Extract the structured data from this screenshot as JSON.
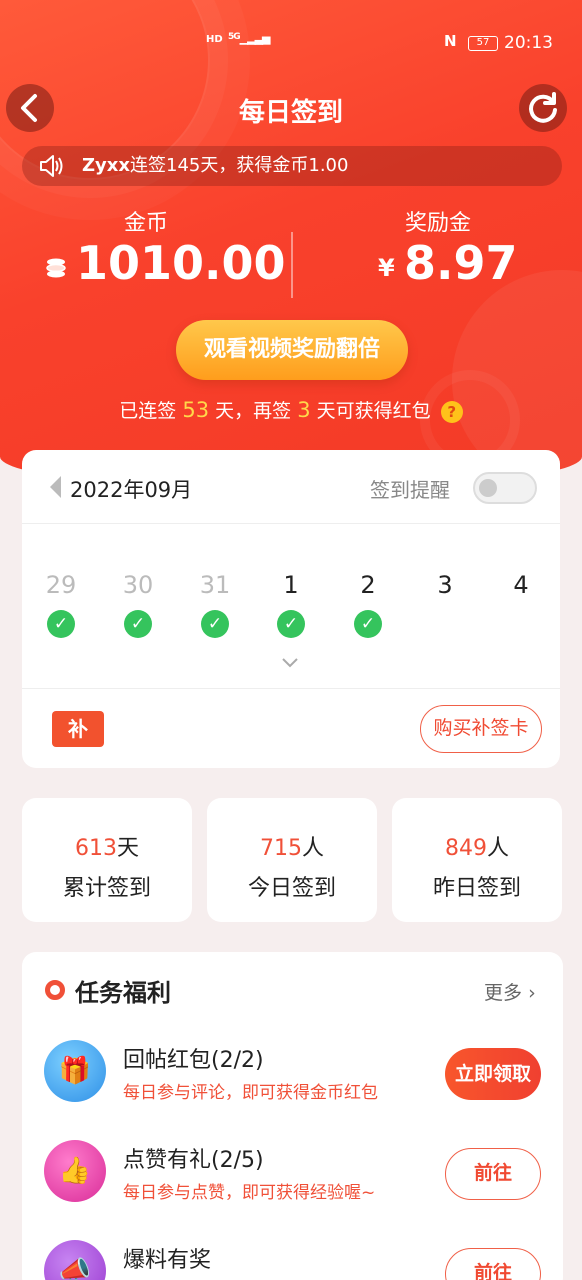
{
  "status_bar": {
    "network": "HD",
    "signal": "5G",
    "nfc": "N",
    "battery": "57",
    "time": "20:13"
  },
  "header": {
    "title": "每日签到",
    "back_icon": "back-arrow-icon",
    "refresh_icon": "refresh-icon"
  },
  "marquee": {
    "user": "Zyxx",
    "text": "连签145天，获得金币1.00"
  },
  "balances": {
    "coins_label": "金币",
    "coins_value": "1010.00",
    "bonus_label": "奖励金",
    "bonus_currency": "¥",
    "bonus_value": "8.97"
  },
  "watch_button": "观看视频奖励翻倍",
  "streak": {
    "prefix": "已连签",
    "days": "53",
    "mid": "天，再签",
    "remain": "3",
    "suffix": "天可获得红包",
    "help": "?"
  },
  "calendar": {
    "month": "2022年09月",
    "reminder_label": "签到提醒",
    "reminder_on": false,
    "days": [
      {
        "num": "29",
        "past": true,
        "signed": true
      },
      {
        "num": "30",
        "past": true,
        "signed": true
      },
      {
        "num": "31",
        "past": true,
        "signed": true
      },
      {
        "num": "1",
        "past": false,
        "signed": true
      },
      {
        "num": "2",
        "past": false,
        "signed": true
      },
      {
        "num": "3",
        "past": false,
        "signed": false
      },
      {
        "num": "4",
        "past": false,
        "signed": false
      }
    ],
    "makeup_icon_text": "补",
    "buy_button": "购买补签卡"
  },
  "stats": [
    {
      "value": "613",
      "unit": "天",
      "label": "累计签到"
    },
    {
      "value": "715",
      "unit": "人",
      "label": "今日签到"
    },
    {
      "value": "849",
      "unit": "人",
      "label": "昨日签到"
    }
  ],
  "tasks": {
    "title": "任务福利",
    "more": "更多",
    "items": [
      {
        "name": "回帖红包(2/2)",
        "desc": "每日参与评论，即可获得金币红包",
        "button": "立即领取",
        "filled": true,
        "color": "#3aa9f2"
      },
      {
        "name": "点赞有礼(2/5)",
        "desc": "每日参与点赞，即可获得经验喔~",
        "button": "前往",
        "filled": false,
        "color": "#e83aa6"
      },
      {
        "name": "爆料有奖",
        "desc": "",
        "button": "前往",
        "filled": false,
        "color": "#b04ad8"
      }
    ]
  },
  "colors": {
    "primary": "#f33a26",
    "accent_gold": "#ffb42a",
    "check_green": "#35c45d"
  }
}
